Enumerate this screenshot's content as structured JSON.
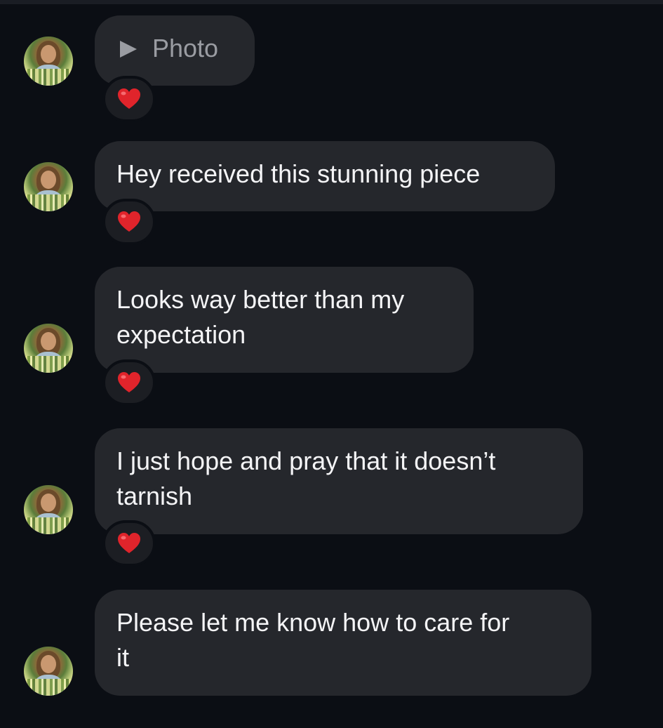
{
  "messages": [
    {
      "kind": "photo",
      "text": "Photo",
      "reaction": "heart-icon"
    },
    {
      "kind": "text",
      "text": "Hey received this stunning piece",
      "reaction": "heart-icon"
    },
    {
      "kind": "text",
      "lines": [
        "Looks way better than my",
        "expectation"
      ],
      "reaction": "heart-icon"
    },
    {
      "kind": "text",
      "lines": [
        "I just hope and pray that it doesn’t",
        "tarnish"
      ],
      "reaction": "heart-icon"
    },
    {
      "kind": "text",
      "lines": [
        "Please let me know how to care for",
        "it"
      ],
      "reaction": null
    }
  ],
  "colors": {
    "background": "#0b0e14",
    "bubble": "#25272c",
    "reaction_bg": "#1c1e23",
    "heart": "#e0242b"
  }
}
